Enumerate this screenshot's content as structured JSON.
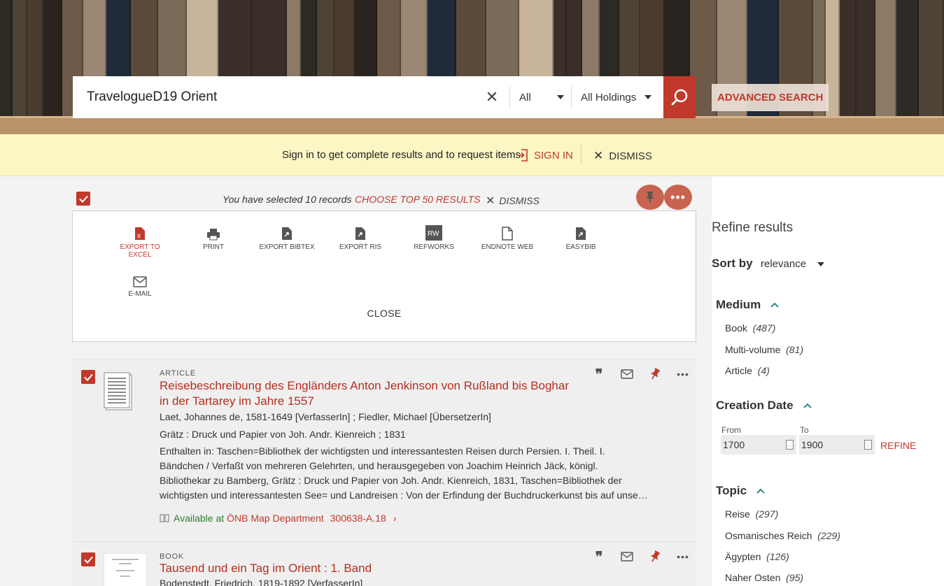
{
  "search": {
    "query": "TravelogueD19 Orient",
    "scope": "All",
    "holdings": "All Holdings",
    "advanced_label": "ADVANCED SEARCH"
  },
  "signin_banner": {
    "text": "Sign in to get complete results and to request items",
    "signin_label": "SIGN IN",
    "dismiss_label": "DISMISS"
  },
  "selection": {
    "text": "You have selected 10 records",
    "top50_label": "CHOOSE TOP 50 RESULTS",
    "dismiss_label": "DISMISS"
  },
  "export_panel": {
    "items": [
      {
        "label": "EXPORT TO EXCEL",
        "icon": "excel-icon"
      },
      {
        "label": "PRINT",
        "icon": "print-icon"
      },
      {
        "label": "EXPORT BIBTEX",
        "icon": "bibtex-icon"
      },
      {
        "label": "EXPORT RIS",
        "icon": "ris-icon"
      },
      {
        "label": "REFWORKS",
        "icon": "refworks-icon"
      },
      {
        "label": "ENDNOTE WEB",
        "icon": "endnote-icon"
      },
      {
        "label": "EASYBIB",
        "icon": "easybib-icon"
      },
      {
        "label": "E-MAIL",
        "icon": "email-icon"
      }
    ],
    "close_label": "CLOSE"
  },
  "results": [
    {
      "type": "ARTICLE",
      "title": "Reisebeschreibung des Engländers Anton Jenkinson von Rußland bis Boghar in der Tartarey im Jahre 1557",
      "author": "Laet, Johannes de, 1581-1649 [VerfasserIn] ; Fiedler, Michael [ÜbersetzerIn]",
      "publication": "Grätz : Druck und Papier von Joh. Andr. Kienreich ; 1831",
      "description": "Enthalten in: Taschen=Bibliothek der wichtigsten und interessantesten Reisen durch Persien. I. Theil. I. Bändchen / Verfaßt von mehreren Gelehrten, und herausgegeben von Joachim Heinrich Jäck, königl. Bibliothekar zu Bamberg, Grätz : Druck und Papier von Joh. Andr. Kienreich, 1831, Taschen=Bibliothek der wichtigsten und interessantesten See= und Landreisen : Von der Erfindung der Buchdruckerkunst bis auf unse…",
      "availability": "Available at",
      "location": "ÖNB Map Department",
      "call_number": "300638-A.18"
    },
    {
      "type": "BOOK",
      "title": "Tausend und ein Tag im Orient : 1. Band",
      "author": "Bodenstedt, Friedrich, 1819-1892 [VerfasserIn]"
    }
  ],
  "sidebar": {
    "title": "Refine results",
    "sort_label": "Sort by",
    "sort_value": "relevance",
    "medium": {
      "title": "Medium",
      "items": [
        {
          "name": "Book",
          "count": "(487)"
        },
        {
          "name": "Multi-volume",
          "count": "(81)"
        },
        {
          "name": "Article",
          "count": "(4)"
        }
      ]
    },
    "creation_date": {
      "title": "Creation Date",
      "from_label": "From",
      "to_label": "To",
      "from_value": "1700",
      "to_value": "1900",
      "refine_label": "REFINE"
    },
    "topic": {
      "title": "Topic",
      "items": [
        {
          "name": "Reise",
          "count": "(297)"
        },
        {
          "name": "Osmanisches Reich",
          "count": "(229)"
        },
        {
          "name": "Ägypten",
          "count": "(126)"
        },
        {
          "name": "Naher Osten",
          "count": "(95)"
        }
      ]
    }
  },
  "colors": {
    "accent": "#c0392b",
    "banner": "#fbf6c4",
    "available": "#2e7d32"
  }
}
